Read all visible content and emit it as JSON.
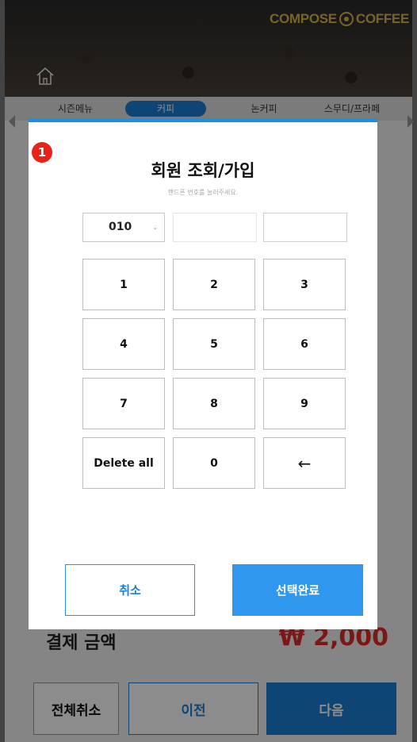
{
  "header": {
    "brand": "COMPOSE COFFEE",
    "brand_part1": "COMPOSE",
    "brand_part2": "COFFEE",
    "home_icon": "home-icon"
  },
  "tabs": [
    {
      "label": "시즌메뉴",
      "active": false
    },
    {
      "label": "커피",
      "active": true
    },
    {
      "label": "논커피",
      "active": false
    },
    {
      "label": "스무디/프라페",
      "active": false
    }
  ],
  "payment": {
    "label": "결제 금액",
    "amount": "₩ 2,000"
  },
  "bottom_buttons": {
    "cancel_all": "전체취소",
    "prev": "이전",
    "next": "다음"
  },
  "modal": {
    "step_badge": "1",
    "title": "회원 조회/가입",
    "subtitle": "핸드폰 번호를 눌러주세요.",
    "phone": {
      "prefix": "010",
      "middle": "",
      "last": ""
    },
    "keys": [
      "1",
      "2",
      "3",
      "4",
      "5",
      "6",
      "7",
      "8",
      "9",
      "Delete all",
      "0",
      "←"
    ],
    "cancel": "취소",
    "confirm": "선택완료"
  },
  "colors": {
    "accent": "#1d7fd4",
    "confirm": "#2f97ee",
    "badge": "#e8221b",
    "brand": "#d9b94a",
    "price": "#e02a2a"
  }
}
